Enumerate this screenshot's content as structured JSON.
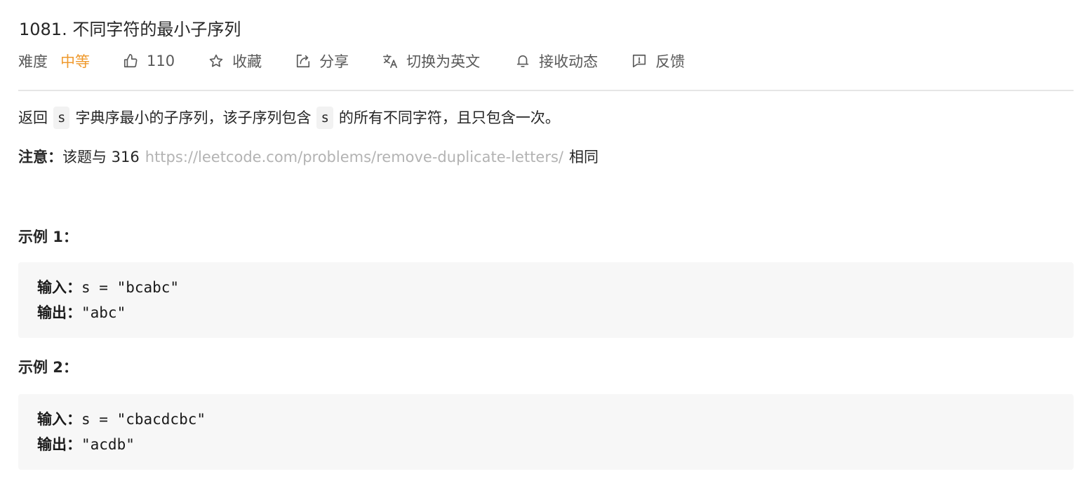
{
  "problem": {
    "title": "1081. 不同字符的最小子序列"
  },
  "meta": {
    "difficulty_label": "难度",
    "difficulty_value": "中等",
    "like_count": "110",
    "favorite_label": "收藏",
    "share_label": "分享",
    "translate_label": "切换为英文",
    "subscribe_label": "接收动态",
    "feedback_label": "反馈",
    "colors": {
      "difficulty": "#ef9a2e",
      "icon": "#595959",
      "link": "#b3b3b3"
    },
    "icons": [
      "thumbs-up-icon",
      "star-icon",
      "share-icon",
      "translate-icon",
      "bell-icon",
      "feedback-icon"
    ]
  },
  "description": {
    "part1": "返回",
    "code1": "s",
    "part2": "字典序最小的子序列，该子序列包含",
    "code2": "s",
    "part3": "的所有不同字符，且只包含一次。"
  },
  "note": {
    "label": "注意：",
    "text_before": "该题与 316",
    "link": "https://leetcode.com/problems/remove-duplicate-letters/",
    "text_after": "相同"
  },
  "examples": [
    {
      "title": "示例 1：",
      "input_label": "输入：",
      "input_value": "s = \"bcabc\"",
      "output_label": "输出：",
      "output_value": "\"abc\""
    },
    {
      "title": "示例 2：",
      "input_label": "输入：",
      "input_value": "s = \"cbacdcbc\"",
      "output_label": "输出：",
      "output_value": "\"acdb\""
    }
  ]
}
